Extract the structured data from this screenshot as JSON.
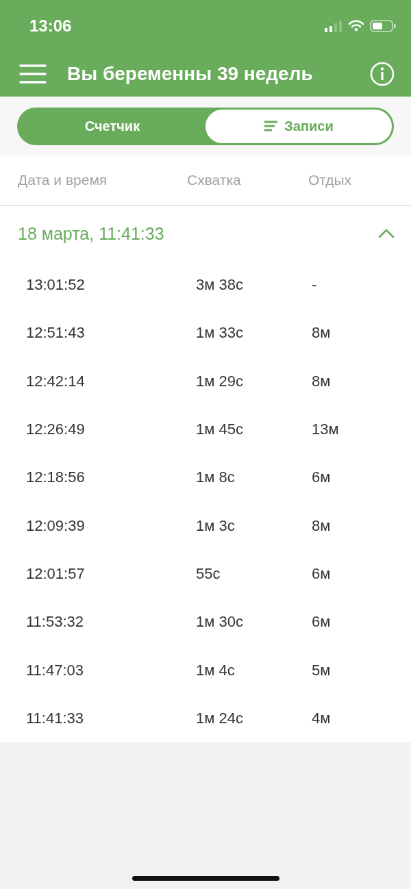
{
  "status_bar": {
    "time": "13:06"
  },
  "header": {
    "title": "Вы беременны 39 недель"
  },
  "tabs": [
    {
      "label": "Счетчик",
      "selected": false,
      "icon": false
    },
    {
      "label": "Записи",
      "selected": true,
      "icon": true
    }
  ],
  "table": {
    "columns": [
      "Дата и время",
      "Схватка",
      "Отдых"
    ],
    "groups": [
      {
        "title": "18 марта, 11:41:33",
        "expanded": true,
        "rows": [
          [
            "13:01:52",
            "3м 38с",
            "-"
          ],
          [
            "12:51:43",
            "1м 33с",
            "8м"
          ],
          [
            "12:42:14",
            "1м 29с",
            "8м"
          ],
          [
            "12:26:49",
            "1м 45с",
            "13м"
          ],
          [
            "12:18:56",
            "1м 8с",
            "6м"
          ],
          [
            "12:09:39",
            "1м 3с",
            "8м"
          ],
          [
            "12:01:57",
            "55с",
            "6м"
          ],
          [
            "11:53:32",
            "1м 30с",
            "6м"
          ],
          [
            "11:47:03",
            "1м 4с",
            "5м"
          ],
          [
            "11:41:33",
            "1м 24с",
            "4м"
          ]
        ]
      }
    ]
  }
}
